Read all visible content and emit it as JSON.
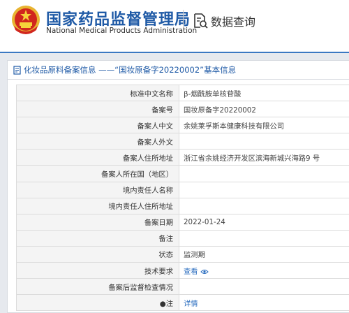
{
  "header": {
    "title_cn": "国家药品监督管理局",
    "title_en": "National Medical Products Administration",
    "query_label": "数据查询"
  },
  "panel": {
    "title": "化妆品原料备案信息 ——“国妆原备字20220002”基本信息"
  },
  "rows": [
    {
      "label": "标准中文名称",
      "value": "β-烟酰胺单核苷酸"
    },
    {
      "label": "备案号",
      "value": "国妆原备字20220002"
    },
    {
      "label": "备案人中文",
      "value": "余姚莱孚斯本健康科技有限公司"
    },
    {
      "label": "备案人外文",
      "value": ""
    },
    {
      "label": "备案人住所地址",
      "value": "浙江省余姚经济开发区滨海新城兴海路9 号"
    },
    {
      "label": "备案人所在国（地区）",
      "value": ""
    },
    {
      "label": "境内责任人名称",
      "value": ""
    },
    {
      "label": "境内责任人住所地址",
      "value": ""
    },
    {
      "label": "备案日期",
      "value": "2022-01-24"
    },
    {
      "label": "备注",
      "value": ""
    },
    {
      "label": "状态",
      "value": "监测期"
    },
    {
      "label": "技术要求",
      "value": "查看"
    },
    {
      "label": "备案后监督检查情况",
      "value": ""
    },
    {
      "label": "●注",
      "value": "详情"
    }
  ]
}
